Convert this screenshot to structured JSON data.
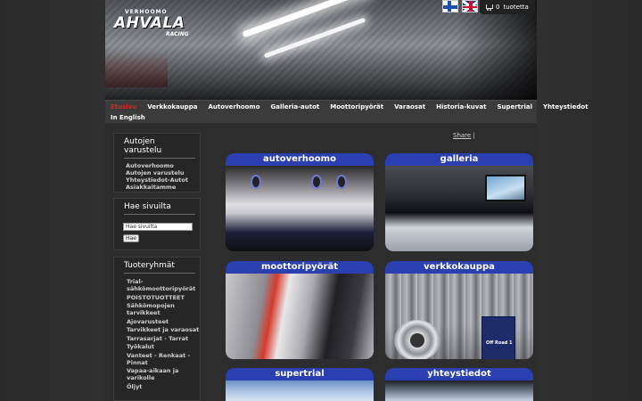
{
  "header": {
    "logo": {
      "top": "VERHOOMO",
      "name": "AHVALA",
      "sub": "RACING"
    },
    "cart": {
      "count": "0",
      "label": "tuotetta"
    }
  },
  "nav": {
    "row1": [
      "Etusivu",
      "Verkkokauppa",
      "Autoverhoomo",
      "Galleria-autot",
      "Moottoripyörät",
      "Varaosat",
      "Historia-kuvat",
      "Supertrial",
      "Yhteystiedot"
    ],
    "row2": [
      "In English"
    ]
  },
  "sidebar": {
    "box1": {
      "title": "Autojen varustelu",
      "links": [
        "Autoverhoomo",
        "Autojen varustelu",
        "Yhteystiedot-Autot",
        "Asiakkaitamme"
      ]
    },
    "search": {
      "title": "Hae sivuilta",
      "value": "Hae sivuilta",
      "button": "Hae"
    },
    "products": {
      "title": "Tuoteryhmät",
      "links": [
        "Trial-sähkömoottoripyörät",
        "POISTOTUOTTEET",
        "Sähkömopojen tarvikkeet",
        "Ajovarusteet",
        "Tarvikkeet ja varaosat",
        "Tarrasarjat - Tarrat",
        "Työkalut",
        "Vanteet - Renkaat - Pinnat",
        "Vapaa-aikaan ja varikolle",
        "Öljyt"
      ]
    }
  },
  "share": {
    "label": "Share",
    "sep": "|"
  },
  "tiles": [
    {
      "title": "autoverhoomo"
    },
    {
      "title": "galleria"
    },
    {
      "title": "moottoripyörät"
    },
    {
      "title": "verkkokauppa",
      "oil_label": "Off Road 1"
    },
    {
      "title": "supertrial"
    },
    {
      "title": "yhteystiedot"
    }
  ],
  "colors": {
    "tile_header": "#2b3fb0",
    "nav_active": "#d8261e",
    "background": "#2d2d2d"
  }
}
